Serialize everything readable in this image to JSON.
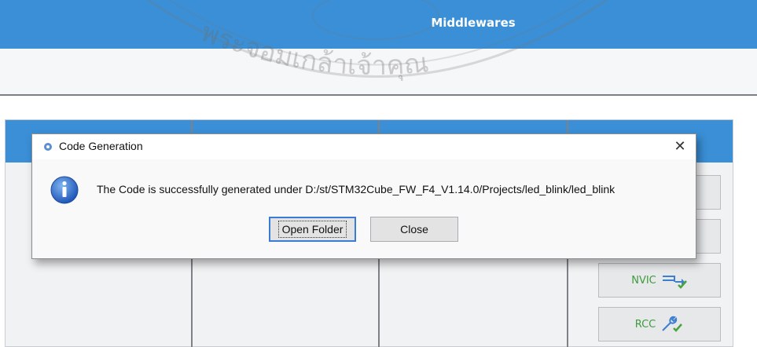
{
  "header": {
    "title": "Middlewares"
  },
  "dialog": {
    "title": "Code Generation",
    "message": "The Code is successfully generated under D:/st/STM32Cube_FW_F4_V1.14.0/Projects/led_blink/led_blink",
    "close_glyph": "✕",
    "open_folder_label": "Open Folder",
    "close_label": "Close"
  },
  "side_buttons": {
    "nvic_label": "NVIC",
    "rcc_label": "RCC"
  },
  "icons": {
    "dialog_app_icon": "gear-icon",
    "info_icon": "info-icon",
    "nvic_icon": "interrupt-icon",
    "rcc_icon": "wrench-icon",
    "check_icon": "checkmark-icon"
  },
  "watermark": {
    "text": "พระจอมเกล้าเจ้าคุณ"
  },
  "colors": {
    "header_blue": "#3a8fd6",
    "status_green": "#4aa33f",
    "default_button_border": "#3a7bd5"
  }
}
